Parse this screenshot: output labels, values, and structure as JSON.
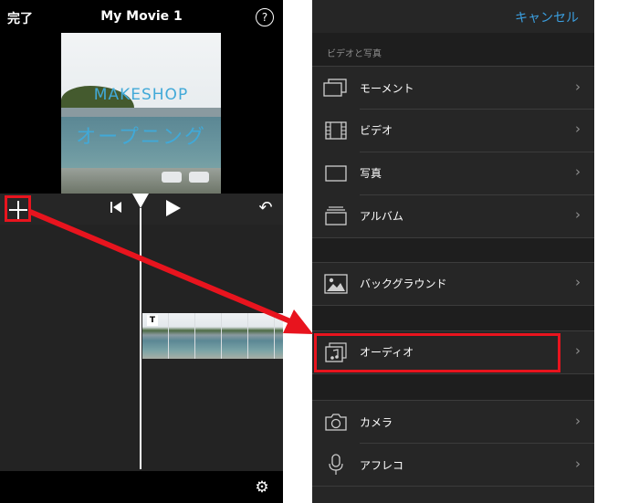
{
  "editor": {
    "done_label": "完了",
    "movie_title": "My Movie 1",
    "help_label": "?",
    "preview_title_en": "MAKESHOP",
    "preview_title_ja": "オープニング",
    "clip_title_badge": "T"
  },
  "media_menu": {
    "cancel_label": "キャンセル",
    "section_header": "ビデオと写真",
    "items": [
      {
        "label": "モーメント",
        "icon": "moments-icon"
      },
      {
        "label": "ビデオ",
        "icon": "film-icon"
      },
      {
        "label": "写真",
        "icon": "photo-icon"
      },
      {
        "label": "アルバム",
        "icon": "album-icon"
      },
      {
        "label": "バックグラウンド",
        "icon": "background-icon"
      },
      {
        "label": "オーディオ",
        "icon": "audio-icon"
      },
      {
        "label": "カメラ",
        "icon": "camera-icon"
      },
      {
        "label": "アフレコ",
        "icon": "microphone-icon"
      }
    ]
  },
  "colors": {
    "highlight": "#e8141e",
    "accent": "#3b9fe0"
  }
}
